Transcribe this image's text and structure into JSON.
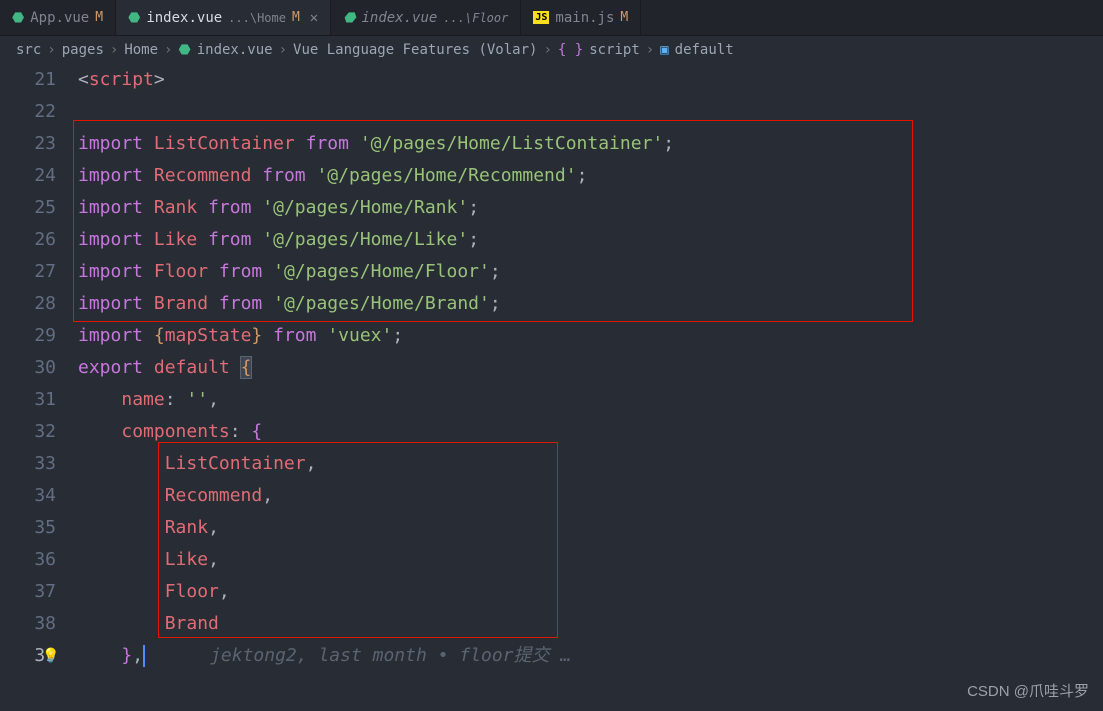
{
  "tabs": [
    {
      "icon": "vue",
      "label": "App.vue",
      "suffix": "M",
      "active": false,
      "italic": false
    },
    {
      "icon": "vue",
      "label": "index.vue",
      "path": "...\\Home",
      "suffix": "M",
      "active": true,
      "italic": false,
      "close": true
    },
    {
      "icon": "vue",
      "label": "index.vue",
      "path": "...\\Floor",
      "suffix": "",
      "active": false,
      "italic": true
    },
    {
      "icon": "js",
      "label": "main.js",
      "suffix": "M",
      "active": false,
      "italic": false
    }
  ],
  "breadcrumbs": {
    "parts": [
      "src",
      "pages",
      "Home",
      "index.vue",
      "Vue Language Features (Volar)",
      "script",
      "default"
    ],
    "chevron": "›"
  },
  "line_numbers": [
    "21",
    "22",
    "23",
    "24",
    "25",
    "26",
    "27",
    "28",
    "29",
    "30",
    "31",
    "32",
    "33",
    "34",
    "35",
    "36",
    "37",
    "38",
    "39"
  ],
  "code": {
    "l21": {
      "tag_open": "<",
      "tag_name": "script",
      "tag_close": ">"
    },
    "l23": {
      "kw": "import",
      "name": "ListContainer",
      "from": "from",
      "str": "'@/pages/Home/ListContainer'"
    },
    "l24": {
      "kw": "import",
      "name": "Recommend",
      "from": "from",
      "str": "'@/pages/Home/Recommend'"
    },
    "l25": {
      "kw": "import",
      "name": "Rank",
      "from": "from",
      "str": "'@/pages/Home/Rank'"
    },
    "l26": {
      "kw": "import",
      "name": "Like",
      "from": "from",
      "str": "'@/pages/Home/Like'"
    },
    "l27": {
      "kw": "import",
      "name": "Floor",
      "from": "from",
      "str": "'@/pages/Home/Floor'"
    },
    "l28": {
      "kw": "import",
      "name": "Brand",
      "from": "from",
      "str": "'@/pages/Home/Brand'"
    },
    "l29": {
      "kw": "import",
      "name": "mapState",
      "from": "from",
      "str": "'vuex'"
    },
    "l30": {
      "kw1": "export",
      "kw2": "default",
      "brace": "{"
    },
    "l31": {
      "prop": "name",
      "val": "''"
    },
    "l32": {
      "prop": "components",
      "brace": "{"
    },
    "l33": {
      "name": "ListContainer"
    },
    "l34": {
      "name": "Recommend"
    },
    "l35": {
      "name": "Rank"
    },
    "l36": {
      "name": "Like"
    },
    "l37": {
      "name": "Floor"
    },
    "l38": {
      "name": "Brand"
    },
    "l39": {
      "brace": "}",
      "blame": "jektong2, last month • floor提交 …"
    }
  },
  "watermark": "CSDN @爪哇斗罗"
}
